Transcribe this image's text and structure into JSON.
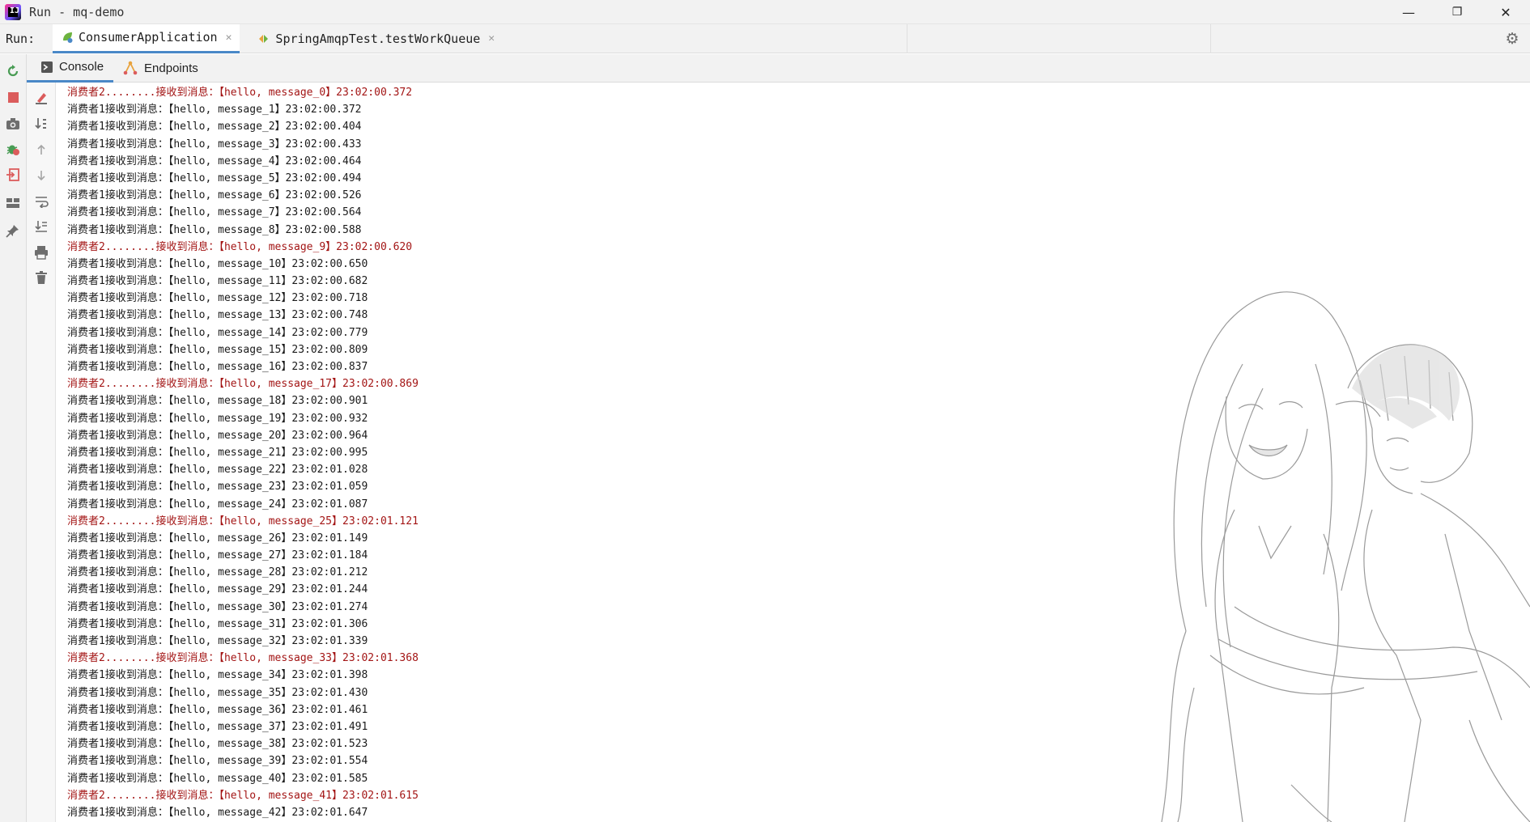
{
  "window": {
    "title": "Run - mq-demo",
    "minimize_glyph": "—",
    "restore_glyph": "❐",
    "close_glyph": "✕"
  },
  "runbar": {
    "label": "Run:",
    "tabs": [
      {
        "label": "ConsumerApplication",
        "icon": "spring-boot-icon",
        "active": true
      },
      {
        "label": "SpringAmqpTest.testWorkQueue",
        "icon": "test-run-icon",
        "active": false
      }
    ],
    "settings_icon": "gear-icon"
  },
  "console_tabs": [
    {
      "label": "Console",
      "icon": "console-icon"
    },
    {
      "label": "Endpoints",
      "icon": "endpoints-icon"
    }
  ],
  "left_toolbar": [
    "rerun-icon",
    "stop-icon",
    "camera-icon",
    "debug-icon",
    "exit-icon",
    "layout-icon",
    "pin-icon"
  ],
  "console_toolbar": [
    "clear-edit-icon",
    "sort-icon",
    "up-arrow-icon",
    "down-arrow-icon",
    "soft-wrap-icon",
    "scroll-end-icon",
    "print-icon",
    "trash-icon"
  ],
  "colors": {
    "consumer2": "#a31515",
    "consumer1": "#1a1a1a",
    "accent": "#4a88c7"
  },
  "log": [
    {
      "c": 2,
      "text": "消费者2........接收到消息：【hello, message_0】23:02:00.372"
    },
    {
      "c": 1,
      "text": "消费者1接收到消息：【hello, message_1】23:02:00.372"
    },
    {
      "c": 1,
      "text": "消费者1接收到消息：【hello, message_2】23:02:00.404"
    },
    {
      "c": 1,
      "text": "消费者1接收到消息：【hello, message_3】23:02:00.433"
    },
    {
      "c": 1,
      "text": "消费者1接收到消息：【hello, message_4】23:02:00.464"
    },
    {
      "c": 1,
      "text": "消费者1接收到消息：【hello, message_5】23:02:00.494"
    },
    {
      "c": 1,
      "text": "消费者1接收到消息：【hello, message_6】23:02:00.526"
    },
    {
      "c": 1,
      "text": "消费者1接收到消息：【hello, message_7】23:02:00.564"
    },
    {
      "c": 1,
      "text": "消费者1接收到消息：【hello, message_8】23:02:00.588"
    },
    {
      "c": 2,
      "text": "消费者2........接收到消息：【hello, message_9】23:02:00.620"
    },
    {
      "c": 1,
      "text": "消费者1接收到消息：【hello, message_10】23:02:00.650"
    },
    {
      "c": 1,
      "text": "消费者1接收到消息：【hello, message_11】23:02:00.682"
    },
    {
      "c": 1,
      "text": "消费者1接收到消息：【hello, message_12】23:02:00.718"
    },
    {
      "c": 1,
      "text": "消费者1接收到消息：【hello, message_13】23:02:00.748"
    },
    {
      "c": 1,
      "text": "消费者1接收到消息：【hello, message_14】23:02:00.779"
    },
    {
      "c": 1,
      "text": "消费者1接收到消息：【hello, message_15】23:02:00.809"
    },
    {
      "c": 1,
      "text": "消费者1接收到消息：【hello, message_16】23:02:00.837"
    },
    {
      "c": 2,
      "text": "消费者2........接收到消息：【hello, message_17】23:02:00.869"
    },
    {
      "c": 1,
      "text": "消费者1接收到消息：【hello, message_18】23:02:00.901"
    },
    {
      "c": 1,
      "text": "消费者1接收到消息：【hello, message_19】23:02:00.932"
    },
    {
      "c": 1,
      "text": "消费者1接收到消息：【hello, message_20】23:02:00.964"
    },
    {
      "c": 1,
      "text": "消费者1接收到消息：【hello, message_21】23:02:00.995"
    },
    {
      "c": 1,
      "text": "消费者1接收到消息：【hello, message_22】23:02:01.028"
    },
    {
      "c": 1,
      "text": "消费者1接收到消息：【hello, message_23】23:02:01.059"
    },
    {
      "c": 1,
      "text": "消费者1接收到消息：【hello, message_24】23:02:01.087"
    },
    {
      "c": 2,
      "text": "消费者2........接收到消息：【hello, message_25】23:02:01.121"
    },
    {
      "c": 1,
      "text": "消费者1接收到消息：【hello, message_26】23:02:01.149"
    },
    {
      "c": 1,
      "text": "消费者1接收到消息：【hello, message_27】23:02:01.184"
    },
    {
      "c": 1,
      "text": "消费者1接收到消息：【hello, message_28】23:02:01.212"
    },
    {
      "c": 1,
      "text": "消费者1接收到消息：【hello, message_29】23:02:01.244"
    },
    {
      "c": 1,
      "text": "消费者1接收到消息：【hello, message_30】23:02:01.274"
    },
    {
      "c": 1,
      "text": "消费者1接收到消息：【hello, message_31】23:02:01.306"
    },
    {
      "c": 1,
      "text": "消费者1接收到消息：【hello, message_32】23:02:01.339"
    },
    {
      "c": 2,
      "text": "消费者2........接收到消息：【hello, message_33】23:02:01.368"
    },
    {
      "c": 1,
      "text": "消费者1接收到消息：【hello, message_34】23:02:01.398"
    },
    {
      "c": 1,
      "text": "消费者1接收到消息：【hello, message_35】23:02:01.430"
    },
    {
      "c": 1,
      "text": "消费者1接收到消息：【hello, message_36】23:02:01.461"
    },
    {
      "c": 1,
      "text": "消费者1接收到消息：【hello, message_37】23:02:01.491"
    },
    {
      "c": 1,
      "text": "消费者1接收到消息：【hello, message_38】23:02:01.523"
    },
    {
      "c": 1,
      "text": "消费者1接收到消息：【hello, message_39】23:02:01.554"
    },
    {
      "c": 1,
      "text": "消费者1接收到消息：【hello, message_40】23:02:01.585"
    },
    {
      "c": 2,
      "text": "消费者2........接收到消息：【hello, message_41】23:02:01.615"
    },
    {
      "c": 1,
      "text": "消费者1接收到消息：【hello, message_42】23:02:01.647"
    }
  ]
}
